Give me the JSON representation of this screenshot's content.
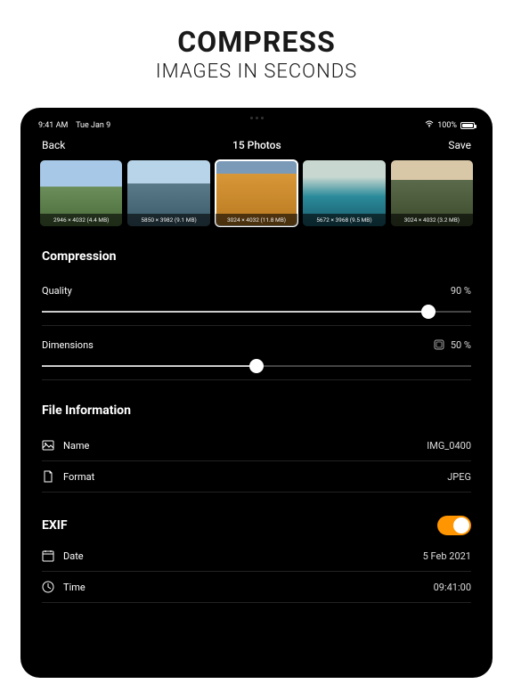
{
  "marketing": {
    "title": "COMPRESS",
    "subtitle": "IMAGES IN SECONDS"
  },
  "status_bar": {
    "time": "9:41 AM",
    "date": "Tue Jan 9",
    "battery_pct": "100%"
  },
  "nav": {
    "back": "Back",
    "title": "15 Photos",
    "save": "Save"
  },
  "thumbnails": [
    {
      "dims": "2946 × 4032 (4.4 MB)"
    },
    {
      "dims": "5850 × 3982 (9.1 MB)"
    },
    {
      "dims": "3024 × 4032 (11.8 MB)"
    },
    {
      "dims": "5672 × 3968 (9.5 MB)"
    },
    {
      "dims": "3024 × 4032 (3.2 MB)"
    }
  ],
  "compression": {
    "section_label": "Compression",
    "quality_label": "Quality",
    "quality_value": "90 %",
    "quality_pct": 90,
    "dimensions_label": "Dimensions",
    "dimensions_value": "50 %",
    "dimensions_pct": 50
  },
  "file_info": {
    "section_label": "File Information",
    "name_label": "Name",
    "name_value": "IMG_0400",
    "format_label": "Format",
    "format_value": "JPEG"
  },
  "exif": {
    "section_label": "EXIF",
    "toggle_on": true,
    "date_label": "Date",
    "date_value": "5 Feb 2021",
    "time_label": "Time",
    "time_value": "09:41:00"
  }
}
